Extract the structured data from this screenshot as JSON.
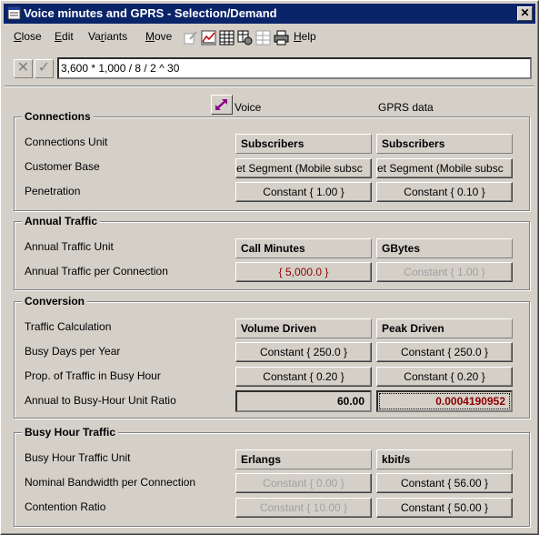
{
  "window": {
    "title": "Voice minutes and GPRS  - Selection/Demand",
    "close_glyph": "✕"
  },
  "menu": [
    {
      "label": "Close",
      "key": "C"
    },
    {
      "label": "Edit",
      "key": "E"
    },
    {
      "label": "Variants",
      "key": "r"
    },
    {
      "label": "Move",
      "key": "M"
    },
    {
      "label": "Help",
      "key": "H"
    }
  ],
  "toolbar_icons": [
    "edit-icon",
    "chart-icon",
    "table-icon",
    "settings-icon",
    "grid-icon",
    "print-icon"
  ],
  "formula": {
    "value": "3,600 * 1,000 / 8 / 2 ^ 30",
    "cancel_glyph": "✕",
    "accept_glyph": "✓"
  },
  "columns": {
    "voice": "Voice",
    "gprs": "GPRS data"
  },
  "colors": {
    "title_bg": "#0a246a",
    "red_value": "#8b0000",
    "swap_icon": "#8b008b"
  },
  "groups": {
    "connections": {
      "title": "Connections",
      "rows": [
        {
          "label": "Connections Unit",
          "voice": "Subscribers",
          "gprs": "Subscribers"
        },
        {
          "label": "Customer Base",
          "voice": "et Segment (Mobile subsc",
          "gprs": "et Segment (Mobile subsc"
        },
        {
          "label": "Penetration",
          "voice": "Constant { 1.00 }",
          "gprs": "Constant { 0.10 }"
        }
      ]
    },
    "annual": {
      "title": "Annual Traffic",
      "rows": [
        {
          "label": "Annual Traffic Unit",
          "voice": "Call Minutes",
          "gprs": "GBytes"
        },
        {
          "label": "Annual Traffic per Connection",
          "voice": "{ 5,000.0 }",
          "gprs": "Constant { 1.00 }"
        }
      ]
    },
    "conversion": {
      "title": "Conversion",
      "rows": [
        {
          "label": "Traffic Calculation",
          "voice": "Volume Driven",
          "gprs": "Peak Driven"
        },
        {
          "label": "Busy Days per Year",
          "voice": "Constant { 250.0 }",
          "gprs": "Constant { 250.0 }"
        },
        {
          "label": "Prop. of Traffic in Busy Hour",
          "voice": "Constant { 0.20 }",
          "gprs": "Constant { 0.20 }"
        },
        {
          "label": "Annual to Busy-Hour Unit Ratio",
          "voice": "60.00",
          "gprs": "0.0004190952"
        }
      ]
    },
    "busy": {
      "title": "Busy Hour Traffic",
      "rows": [
        {
          "label": "Busy Hour Traffic Unit",
          "voice": "Erlangs",
          "gprs": "kbit/s"
        },
        {
          "label": "Nominal Bandwidth per Connection",
          "voice": "Constant { 0.00 }",
          "gprs": "Constant { 56.00 }"
        },
        {
          "label": "Contention Ratio",
          "voice": "Constant { 10.00 }",
          "gprs": "Constant { 50.00 }"
        }
      ]
    }
  }
}
